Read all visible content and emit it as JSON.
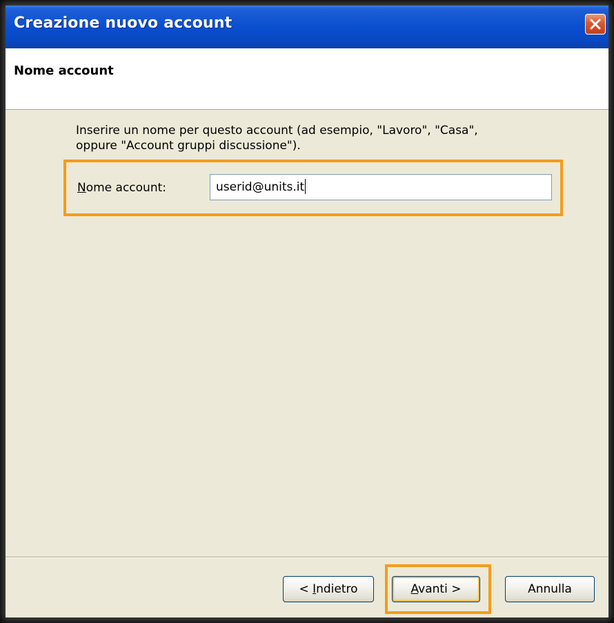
{
  "window": {
    "title": "Creazione nuovo account",
    "close_icon": "close-icon"
  },
  "header": {
    "title": "Nome account"
  },
  "content": {
    "instructions_line1": "Inserire un nome per questo account (ad esempio, \"Lavoro\", \"Casa\",",
    "instructions_line2": "oppure \"Account gruppi discussione\").",
    "field_label_first": "N",
    "field_label_rest": "ome account:",
    "account_name_value": "userid@units.it"
  },
  "buttons": {
    "back_prefix": "< ",
    "back_mnemonic": "I",
    "back_rest": "ndietro",
    "next_mnemonic": "A",
    "next_rest": "vanti >",
    "cancel": "Annulla"
  },
  "colors": {
    "highlight": "#f39c1a",
    "titlebar": "#0a4fd0",
    "dialog_bg": "#ece9d8"
  }
}
